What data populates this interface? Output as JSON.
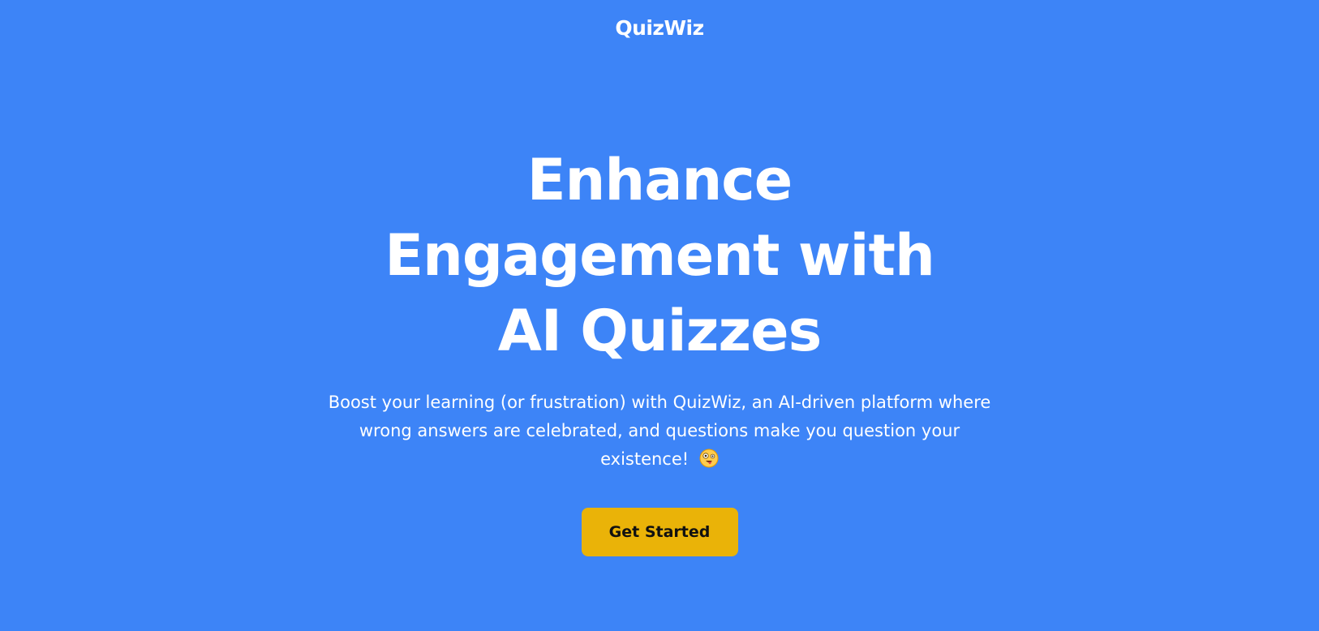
{
  "header": {
    "brand": "QuizWiz"
  },
  "hero": {
    "title_lines": [
      "Enhance",
      "Engagement with",
      "AI Quizzes"
    ],
    "subtitle": "Boost your learning (or frustration) with QuizWiz, an AI-driven platform where wrong answers are celebrated, and questions make you question your existence!",
    "subtitle_icon": "zany-face-emoji-icon",
    "cta_label": "Get Started"
  },
  "colors": {
    "background": "#3d84f7",
    "text": "#ffffff",
    "cta_background": "#eab308",
    "cta_text": "#111111"
  }
}
